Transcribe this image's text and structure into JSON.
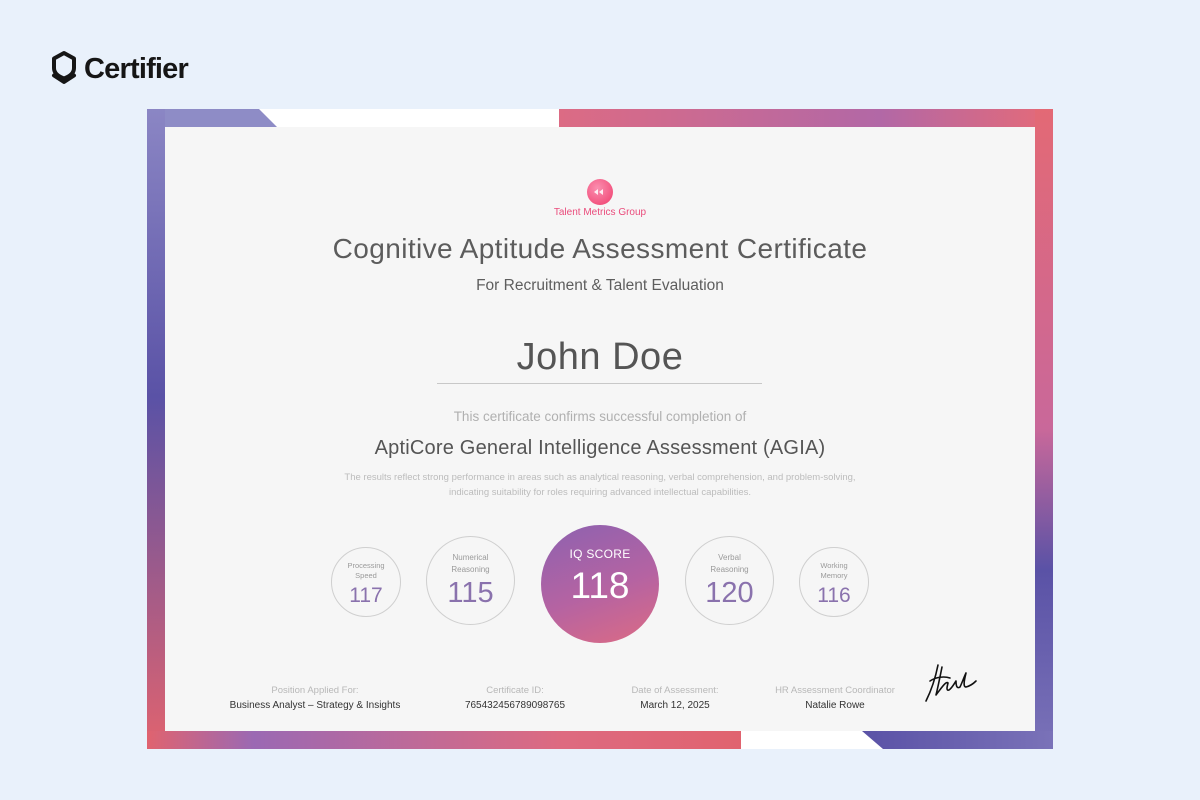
{
  "brand": {
    "name": "Certifier",
    "icon": "certifier-shield-icon"
  },
  "certificate": {
    "issuer": {
      "name": "Talent Metrics Group",
      "logo_icon": "spark-circle-logo"
    },
    "title": "Cognitive Aptitude Assessment Certificate",
    "subtitle": "For Recruitment & Talent Evaluation",
    "recipient": "John Doe",
    "confirmation": "This certificate confirms successful completion of",
    "course": "AptiCore General Intelligence Assessment (AGIA)",
    "description_line1": "The results reflect strong performance in areas such as analytical reasoning, verbal comprehension, and problem-solving,",
    "description_line2": "indicating suitability for roles requiring advanced intellectual capabilities.",
    "scores": {
      "processing_speed": {
        "label_line1": "Processing",
        "label_line2": "Speed",
        "value": "117"
      },
      "numerical_reasoning": {
        "label_line1": "Numerical",
        "label_line2": "Reasoning",
        "value": "115"
      },
      "iq": {
        "label": "IQ SCORE",
        "value": "118"
      },
      "verbal_reasoning": {
        "label_line1": "Verbal",
        "label_line2": "Reasoning",
        "value": "120"
      },
      "working_memory": {
        "label_line1": "Working",
        "label_line2": "Memory",
        "value": "116"
      }
    },
    "footer": {
      "position": {
        "label": "Position Applied For:",
        "value": "Business Analyst – Strategy & Insights"
      },
      "certificate_id": {
        "label": "Certificate ID:",
        "value": "765432456789098765"
      },
      "date": {
        "label": "Date of Assessment:",
        "value": "March 12, 2025"
      },
      "coordinator": {
        "label": "HR Assessment Coordinator",
        "value": "Natalie Rowe"
      }
    }
  },
  "colors": {
    "background": "#e9f1fb",
    "accent_purple": "#8d62b0",
    "accent_pink": "#dc6b84",
    "frame_blue": "#5a52a6",
    "issuer_pink": "#ea4c7c"
  }
}
